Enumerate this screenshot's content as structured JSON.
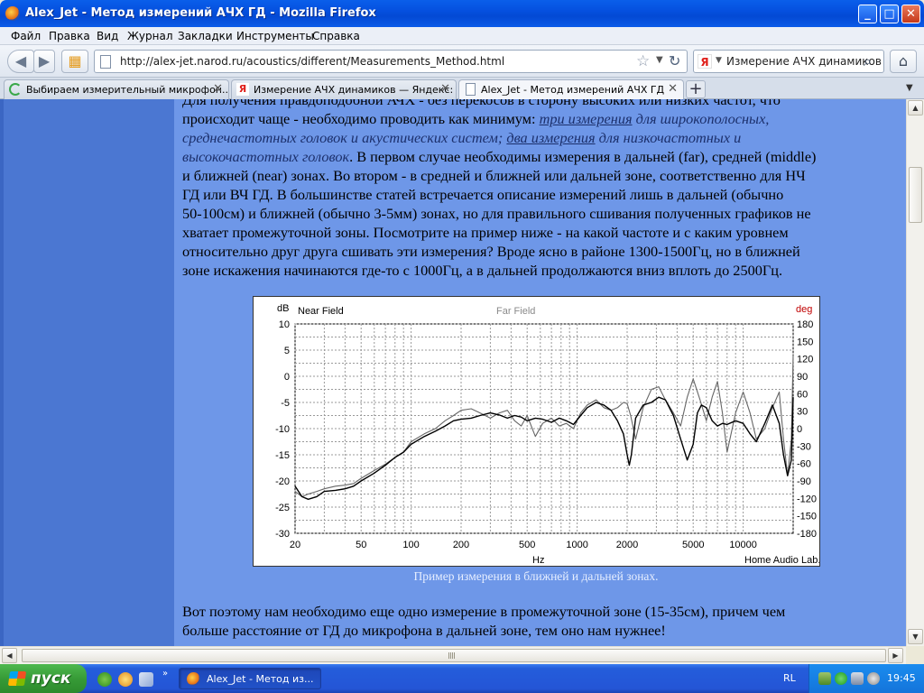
{
  "window": {
    "title": "Alex_Jet - Метод измерений АЧХ ГД - Mozilla Firefox"
  },
  "menu": [
    "Файл",
    "Правка",
    "Вид",
    "Журнал",
    "Закладки",
    "Инструменты",
    "Справка"
  ],
  "nav": {
    "url": "http://alex-jet.narod.ru/acoustics/different/Measurements_Method.html",
    "search_text": "Измерение АЧХ динамиков",
    "search_engine_logo": "Я"
  },
  "tabs": [
    {
      "label": "Выбираем измерительный микрофон...",
      "active": false
    },
    {
      "label": "Измерение АЧХ динамиков — Яндекс: ...",
      "active": false
    },
    {
      "label": "Alex_Jet - Метод измерений АЧХ ГД",
      "active": true
    }
  ],
  "article": {
    "para1_line0": "Для получения правдоподобной АЧХ - без перекосов в сторону высоких или низких частот, что",
    "para1_line1a": "происходит чаще - необходимо проводить как минимум: ",
    "para1_link1": "три измерения",
    "para1_line1b": " для широкополосных,",
    "para1_line2a": "среднечастотных головок и акустических систем; ",
    "para1_link2": "два измерения",
    "para1_line2b": " для низкочастотных и",
    "para1_line3a": "высокочастотных головок",
    "para1_line3b": ". В первом случае необходимы измерения в дальней (far), средней (middle)",
    "para1_line4": "и ближней (near) зонах. Во втором - в средней и ближней или дальней зоне, соответственно для НЧ",
    "para1_line5": "ГД или ВЧ ГД. В большинстве статей встречается описание измерений лишь в дальней (обычно",
    "para1_line6": "50-100см) и ближней (обычно 3-5мм) зонах, но для правильного сшивания полученных графиков не",
    "para1_line7": "хватает промежуточной зоны. Посмотрите на пример ниже - на какой частоте и с каким уровнем",
    "para1_line8": "относительно друг друга сшивать эти измерения? Вроде ясно в районе 1300-1500Гц, но в ближней",
    "para1_line9": "зоне искажения начинаются где-то с 1000Гц, а в дальней продолжаются вниз вплоть до 2500Гц.",
    "caption": "Пример измерения в ближней и дальней зонах.",
    "para2_line0": "Вот поэтому нам необходимо еще одно измерение в промежуточной зоне (15-35см), причем чем",
    "para2_line1": "больше расстояние от ГД до микрофона в дальней зоне, тем оно нам нужнее!"
  },
  "chart_data": {
    "type": "line",
    "xscale": "log",
    "xlim": [
      20,
      20000
    ],
    "ylim": [
      -30,
      10
    ],
    "y2lim": [
      -180,
      180
    ],
    "ylabel": "dB",
    "y2label": "deg",
    "xlabel": "Hz",
    "brand": "Home Audio Lab.",
    "x_ticks": [
      20,
      50,
      100,
      200,
      500,
      1000,
      2000,
      5000,
      10000
    ],
    "x_tick_labels": [
      "20",
      "50",
      "100",
      "200",
      "500",
      "1000",
      "2000",
      "5000",
      "10000"
    ],
    "y_ticks": [
      10,
      5,
      0,
      -5,
      -10,
      -15,
      -20,
      -25,
      -30
    ],
    "y2_ticks": [
      180,
      150,
      120,
      90,
      60,
      30,
      0,
      -30,
      -60,
      -90,
      -120,
      -150,
      -180
    ],
    "grid": true,
    "series": [
      {
        "name": "Near Field",
        "color": "#000000",
        "x": [
          20,
          22,
          24,
          27,
          30,
          35,
          40,
          45,
          50,
          60,
          70,
          80,
          90,
          100,
          120,
          140,
          160,
          180,
          200,
          230,
          260,
          300,
          340,
          380,
          420,
          460,
          500,
          560,
          620,
          700,
          780,
          860,
          950,
          1050,
          1150,
          1300,
          1450,
          1600,
          1750,
          1900,
          2000,
          2060,
          2120,
          2250,
          2500,
          2800,
          3100,
          3400,
          3800,
          4200,
          4600,
          5000,
          5300,
          5600,
          6000,
          6500,
          7000,
          7500,
          8000,
          9000,
          10000,
          11000,
          12000,
          13500,
          15000,
          16500,
          17500,
          18500,
          19500,
          20000
        ],
        "y": [
          -21,
          -23,
          -23.5,
          -23,
          -22,
          -21.8,
          -21.5,
          -21,
          -20,
          -18.5,
          -17,
          -15.5,
          -14.5,
          -13,
          -11.5,
          -10.5,
          -9.5,
          -8.5,
          -8.2,
          -8,
          -7.5,
          -7,
          -7.4,
          -8,
          -7.5,
          -7.8,
          -8.5,
          -8,
          -8.2,
          -8.8,
          -8,
          -8.5,
          -9.2,
          -7.5,
          -6,
          -5,
          -5.5,
          -6.5,
          -8.5,
          -11,
          -15,
          -17,
          -15,
          -8,
          -5.5,
          -5,
          -4,
          -4.5,
          -7.5,
          -12,
          -16,
          -13,
          -7,
          -5.5,
          -6,
          -8.5,
          -9.5,
          -9,
          -9.2,
          -8.5,
          -9,
          -11,
          -12.5,
          -9,
          -5.5,
          -9,
          -15,
          -19,
          -16,
          -4
        ]
      },
      {
        "name": "Far Field",
        "color": "#666666",
        "x": [
          20,
          22,
          24,
          27,
          30,
          35,
          40,
          45,
          50,
          60,
          70,
          80,
          90,
          100,
          120,
          140,
          160,
          180,
          200,
          230,
          260,
          300,
          340,
          380,
          420,
          460,
          500,
          560,
          620,
          700,
          780,
          860,
          950,
          1050,
          1150,
          1300,
          1450,
          1600,
          1750,
          1900,
          2000,
          2100,
          2250,
          2500,
          2800,
          3100,
          3400,
          3800,
          4200,
          4600,
          5000,
          5500,
          6000,
          6500,
          7000,
          7500,
          8000,
          9000,
          10000,
          11000,
          12000,
          13500,
          15000,
          16500,
          17500,
          18500,
          19500,
          20000
        ],
        "y": [
          -22,
          -23,
          -22.5,
          -22,
          -21.5,
          -21,
          -20.8,
          -20.5,
          -19.5,
          -18,
          -16.8,
          -15.5,
          -14.5,
          -12.5,
          -11,
          -10,
          -8.5,
          -7.5,
          -6.5,
          -6.2,
          -7,
          -8,
          -7,
          -6.5,
          -8.5,
          -9.5,
          -7.5,
          -11.5,
          -9,
          -8,
          -9.5,
          -9,
          -10,
          -7,
          -5.5,
          -4.5,
          -6,
          -6.5,
          -6,
          -5,
          -5.2,
          -7.5,
          -12,
          -6,
          -2.5,
          -2,
          -4.5,
          -7,
          -9.5,
          -4,
          -0.5,
          -4.5,
          -8.5,
          -4,
          -1,
          -7,
          -14.5,
          -7,
          -3,
          -7,
          -12,
          -10,
          -6,
          -3,
          -12,
          -19,
          -12,
          4
        ]
      }
    ]
  },
  "taskbar": {
    "start_label": "пуск",
    "task_label": "Alex_Jet - Метод из...",
    "language": "RL",
    "clock": "19:45"
  }
}
